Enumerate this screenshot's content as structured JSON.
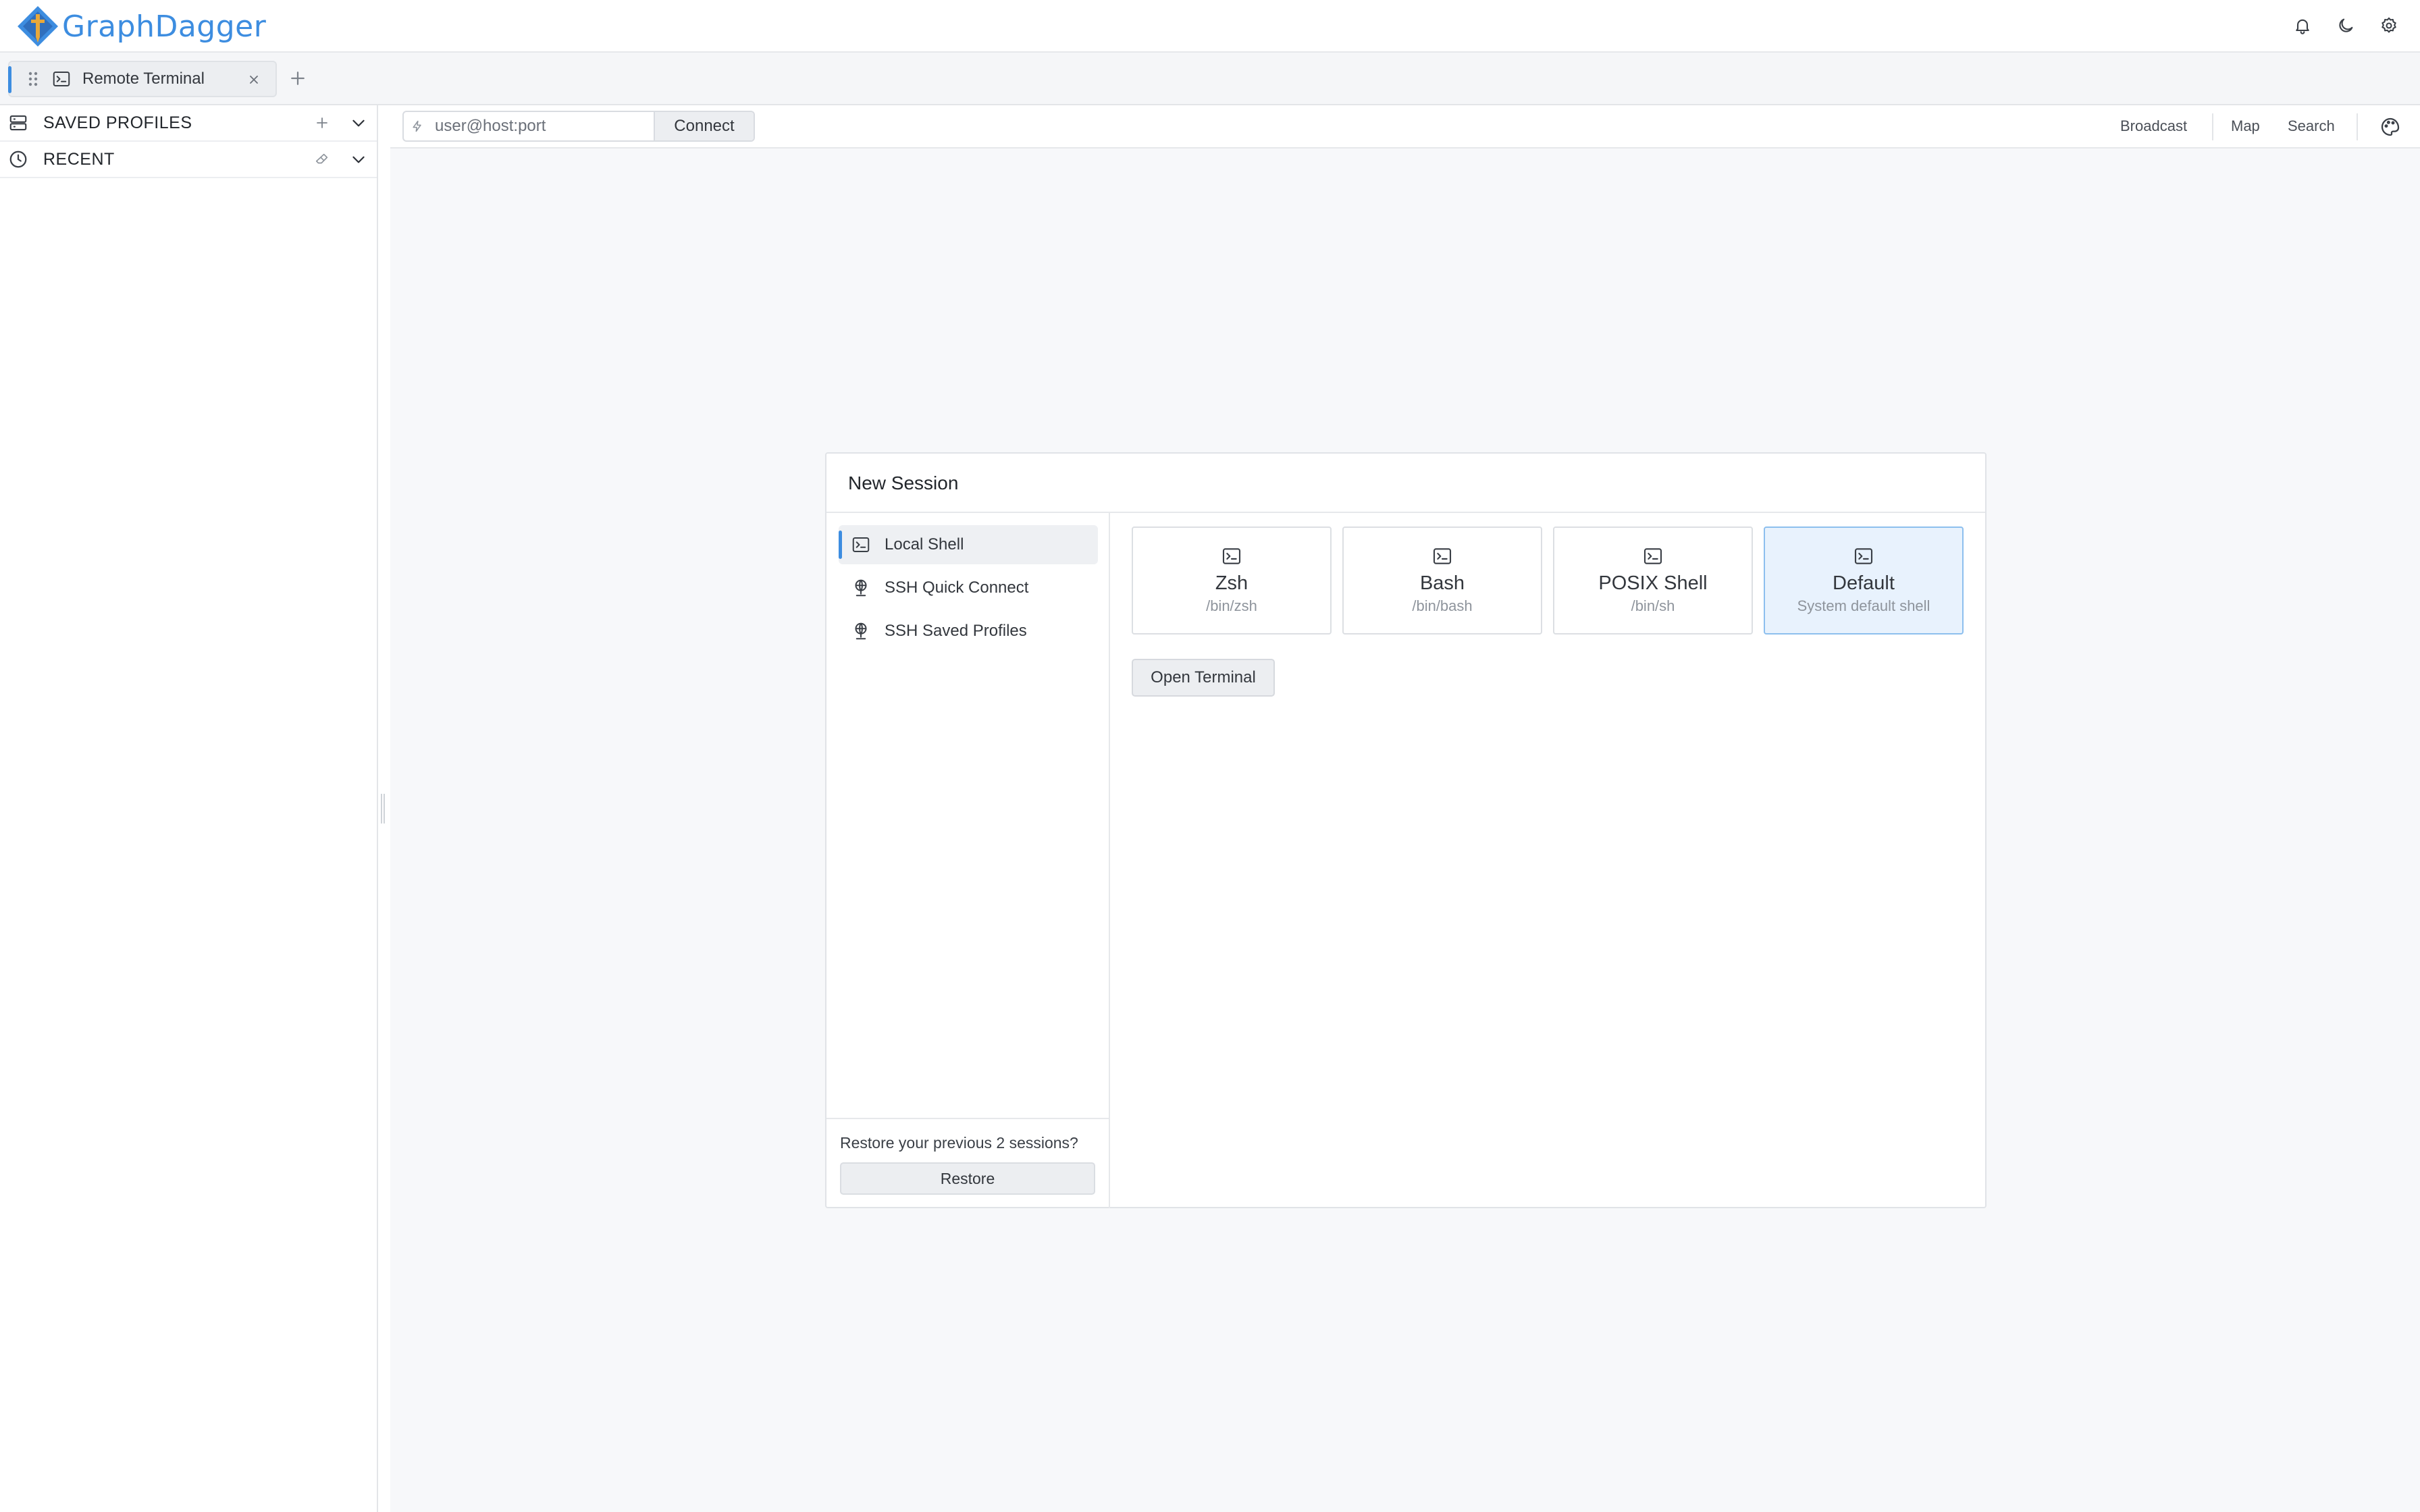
{
  "app": {
    "name": "GraphDagger",
    "icons": {
      "logo": "graphdagger-logo",
      "notifications": "bell-icon",
      "theme": "moon-icon",
      "settings": "gear-icon"
    },
    "colors": {
      "accent": "#3d8de0",
      "selected_bg": "#e8f2fd",
      "selected_border": "#8dbfee"
    }
  },
  "tabs": [
    {
      "title": "Remote Terminal",
      "icon": "terminal-icon",
      "active": true
    }
  ],
  "sidebar": {
    "sections": [
      {
        "label": "SAVED PROFILES",
        "icon": "server-icon",
        "actions": [
          "plus-icon",
          "chevron-down-icon"
        ]
      },
      {
        "label": "RECENT",
        "icon": "clock-icon",
        "actions": [
          "eraser-icon",
          "chevron-down-icon"
        ]
      }
    ]
  },
  "toolbar": {
    "quick_connect_placeholder": "user@host:port",
    "connect_label": "Connect",
    "links": [
      "Broadcast",
      "Map",
      "Search"
    ]
  },
  "dialog": {
    "title": "New Session",
    "nav": [
      {
        "label": "Local Shell",
        "icon": "terminal-icon",
        "active": true
      },
      {
        "label": "SSH Quick Connect",
        "icon": "globe-icon",
        "active": false
      },
      {
        "label": "SSH Saved Profiles",
        "icon": "globe-icon",
        "active": false
      }
    ],
    "shells": [
      {
        "name": "Zsh",
        "path": "/bin/zsh",
        "selected": false
      },
      {
        "name": "Bash",
        "path": "/bin/bash",
        "selected": false
      },
      {
        "name": "POSIX Shell",
        "path": "/bin/sh",
        "selected": false
      },
      {
        "name": "Default",
        "path": "System default shell",
        "selected": true
      }
    ],
    "open_label": "Open Terminal",
    "restore_prompt": "Restore your previous 2 sessions?",
    "restore_label": "Restore"
  }
}
